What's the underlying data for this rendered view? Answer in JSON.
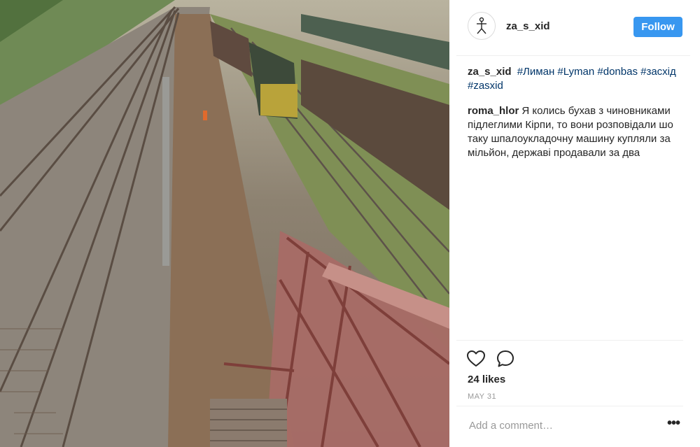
{
  "post": {
    "username": "za_s_xid",
    "follow_label": "Follow",
    "caption": {
      "author": "za_s_xid",
      "hashtags": [
        "#Лиман",
        "#Lyman",
        "#donbas",
        "#засхід",
        "#zasxid"
      ]
    },
    "comments": [
      {
        "author": "roma_hlor",
        "text": "Я колись бухав з чиновниками підлеглими Кірпи, то вони розповідали шо таку шпалоукладочну машину купляли за мільйон, державі продавали за два"
      }
    ],
    "likes": "24 likes",
    "date": "MAY 31",
    "comment_placeholder": "Add a comment…",
    "more_label": "•••"
  },
  "icons": {
    "avatar": "stick-figure-icon",
    "like": "heart-icon",
    "comment": "speech-bubble-icon",
    "more": "ellipsis-icon"
  },
  "colors": {
    "follow_button": "#3897f0",
    "hashtag": "#003569",
    "muted": "#999999"
  }
}
